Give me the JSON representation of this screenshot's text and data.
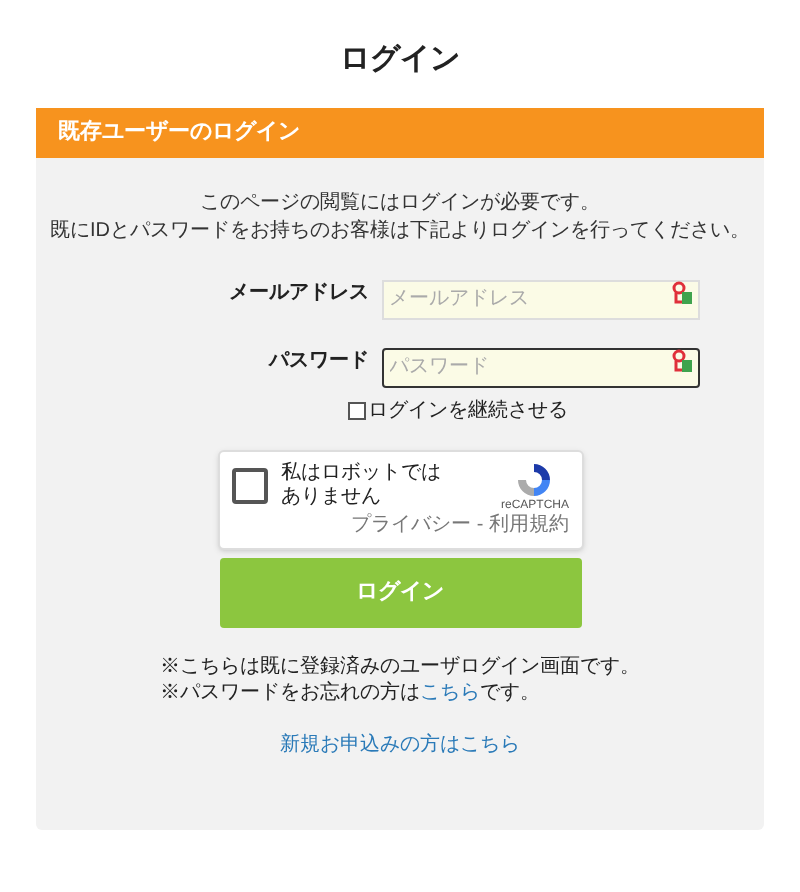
{
  "page_title": "ログイン",
  "panel": {
    "header": "既存ユーザーのログイン",
    "intro": [
      "このページの閲覧にはログインが必要です。",
      "既にIDとパスワードをお持ちのお客様は下記よりログインを行ってください。"
    ],
    "fields": [
      {
        "label": "メールアドレス",
        "placeholder": "メールアドレス",
        "focused": false
      },
      {
        "label": "パスワード",
        "placeholder": "パスワード",
        "focused": true
      }
    ],
    "remember": {
      "label": "ログインを継続させる",
      "checked": false
    },
    "captcha": {
      "label": "私はロボットではありません",
      "checked": false,
      "brand": "reCAPTCHA",
      "terms": "プライバシー - 利用規約"
    },
    "login_button": "ログイン",
    "notes": [
      {
        "before": "※こちらは既に登録済みのユーザログイン画面です。"
      },
      {
        "before": "※パスワードをお忘れの方は",
        "link": "こちら",
        "after": "です。"
      }
    ],
    "signup_link": "新規お申込みの方はこちら"
  }
}
